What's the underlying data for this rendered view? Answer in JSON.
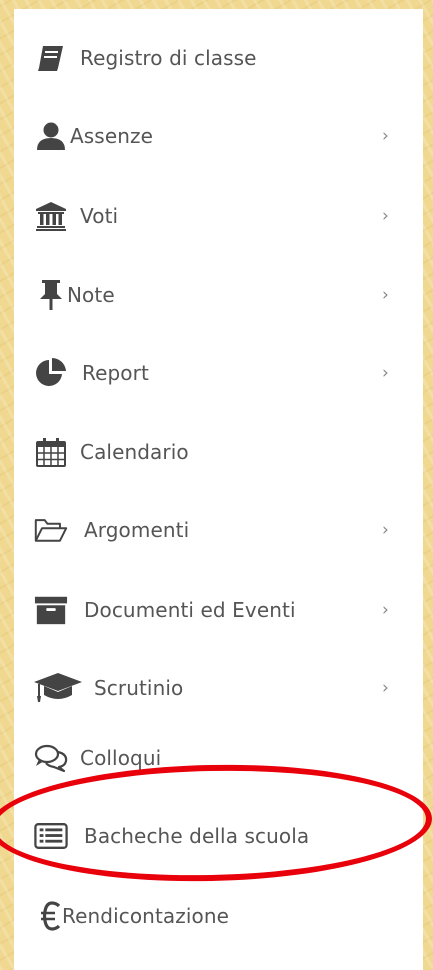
{
  "menu": {
    "items": [
      {
        "label": "Registro di classe",
        "icon": "book-icon",
        "has_submenu": false
      },
      {
        "label": "Assenze",
        "icon": "user-icon",
        "has_submenu": true,
        "chevron": "›"
      },
      {
        "label": "Voti",
        "icon": "university-icon",
        "has_submenu": true,
        "chevron": "›"
      },
      {
        "label": "Note",
        "icon": "pushpin-icon",
        "has_submenu": true,
        "chevron": "›"
      },
      {
        "label": "Report",
        "icon": "pie-chart-icon",
        "has_submenu": true,
        "chevron": "›"
      },
      {
        "label": "Calendario",
        "icon": "calendar-icon",
        "has_submenu": false
      },
      {
        "label": "Argomenti",
        "icon": "folder-open-icon",
        "has_submenu": true,
        "chevron": "›"
      },
      {
        "label": "Documenti ed Eventi",
        "icon": "archive-icon",
        "has_submenu": true,
        "chevron": "›"
      },
      {
        "label": "Scrutinio",
        "icon": "graduation-cap-icon",
        "has_submenu": true,
        "chevron": "›"
      },
      {
        "label": "Colloqui",
        "icon": "comments-icon",
        "has_submenu": false
      },
      {
        "label": "Bacheche della scuola",
        "icon": "list-alt-icon",
        "has_submenu": false,
        "highlighted": true
      },
      {
        "label": "Rendicontazione",
        "icon": "euro-icon",
        "has_submenu": false
      }
    ]
  },
  "colors": {
    "background": "#f0d890",
    "panel": "#ffffff",
    "text": "#555555",
    "icon": "#444444",
    "highlight_ring": "#e8000b"
  }
}
